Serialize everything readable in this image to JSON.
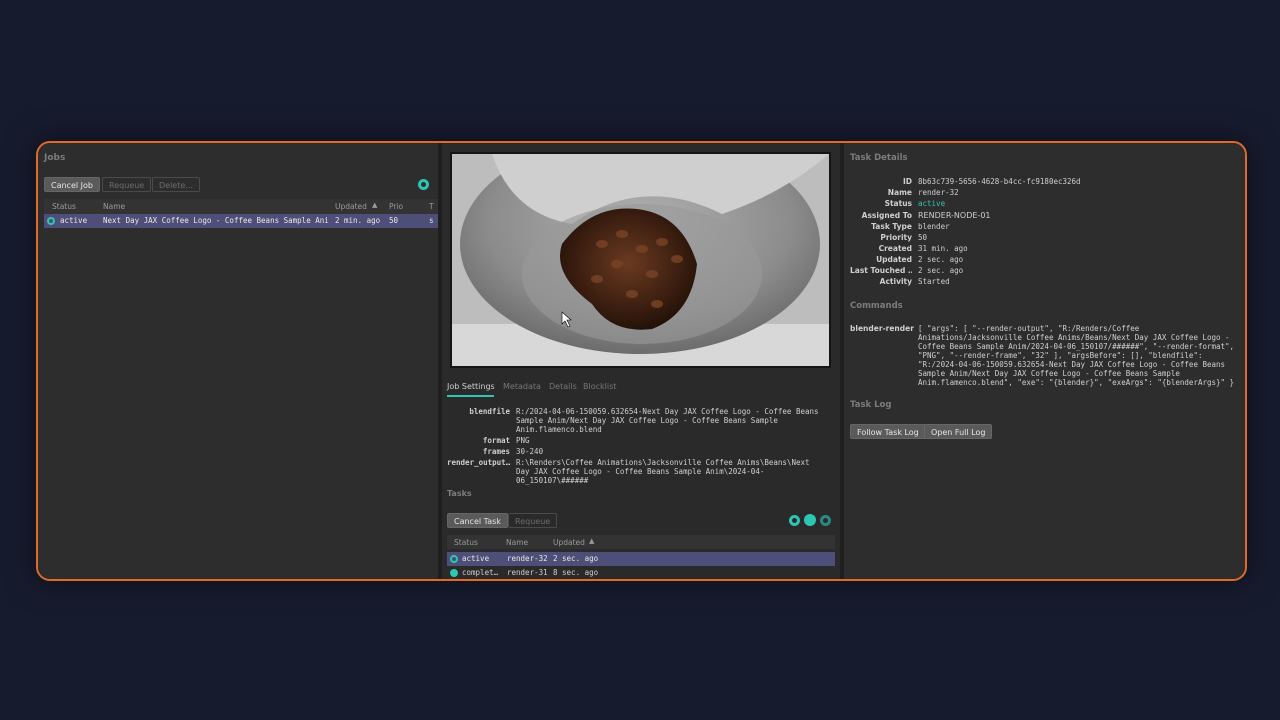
{
  "jobs": {
    "title": "Jobs",
    "buttons": {
      "cancel": "Cancel Job",
      "requeue": "Requeue",
      "delete": "Delete..."
    },
    "columns": {
      "status": "Status",
      "name": "Name",
      "updated": "Updated",
      "prio": "Prio",
      "extra": "T"
    },
    "rows": [
      {
        "status": "active",
        "name": "Next Day JAX Coffee Logo - Coffee Beans Sample Anim",
        "updated": "2 min. ago",
        "prio": "50",
        "extra": "s"
      }
    ]
  },
  "job_detail": {
    "tabs": [
      "Job Settings",
      "Metadata",
      "Details",
      "Blocklist"
    ],
    "settings": [
      {
        "key": "blendfile",
        "value": "R:/2024-04-06-150059.632654-Next Day JAX Coffee Logo - Coffee Beans Sample Anim/Next Day JAX Coffee Logo - Coffee Beans Sample Anim.flamenco.blend"
      },
      {
        "key": "format",
        "value": "PNG"
      },
      {
        "key": "frames",
        "value": "30-240"
      },
      {
        "key": "render_output…",
        "value": "R:\\Renders\\Coffee Animations\\Jacksonville Coffee Anims\\Beans\\Next Day JAX Coffee Logo - Coffee Beans Sample Anim\\2024-04-06_150107\\######"
      }
    ]
  },
  "tasks": {
    "title": "Tasks",
    "buttons": {
      "cancel": "Cancel Task",
      "requeue": "Requeue"
    },
    "columns": {
      "status": "Status",
      "name": "Name",
      "updated": "Updated"
    },
    "rows": [
      {
        "status": "active",
        "name": "render-32",
        "updated": "2 sec. ago"
      },
      {
        "status": "complet…",
        "name": "render-31",
        "updated": "8 sec. ago"
      }
    ]
  },
  "task_details": {
    "title": "Task Details",
    "fields": [
      {
        "key": "ID",
        "value": "8b63c739-5656-4628-b4cc-fc9180ec326d"
      },
      {
        "key": "Name",
        "value": "render-32"
      },
      {
        "key": "Status",
        "value": "active"
      },
      {
        "key": "Assigned To",
        "value": "RENDER-NODE-01"
      },
      {
        "key": "Task Type",
        "value": "blender"
      },
      {
        "key": "Priority",
        "value": "50"
      },
      {
        "key": "Created",
        "value": "31 min. ago"
      },
      {
        "key": "Updated",
        "value": "2 sec. ago"
      },
      {
        "key": "Last Touched …",
        "value": "2 sec. ago"
      },
      {
        "key": "Activity",
        "value": "Started"
      }
    ],
    "commands_title": "Commands",
    "command_key": "blender-render",
    "command_value": "[ \"args\": [ \"--render-output\", \"R:/Renders/Coffee Animations/Jacksonville Coffee Anims/Beans/Next Day JAX Coffee Logo - Coffee Beans Sample Anim/2024-04-06_150107/######\", \"--render-format\", \"PNG\", \"--render-frame\", \"32\" ], \"argsBefore\": [], \"blendfile\": \"R:/2024-04-06-150059.632654-Next Day JAX Coffee Logo - Coffee Beans Sample Anim/Next Day JAX Coffee Logo - Coffee Beans Sample Anim.flamenco.blend\", \"exe\": \"{blender}\", \"exeArgs\": \"{blenderArgs}\" }",
    "log_title": "Task Log",
    "log_buttons": {
      "follow": "Follow Task Log",
      "open": "Open Full Log"
    }
  },
  "colors": {
    "accent": "#2ec5b3",
    "frame_border": "#e06a2a",
    "selected_row": "#4e4f78"
  }
}
